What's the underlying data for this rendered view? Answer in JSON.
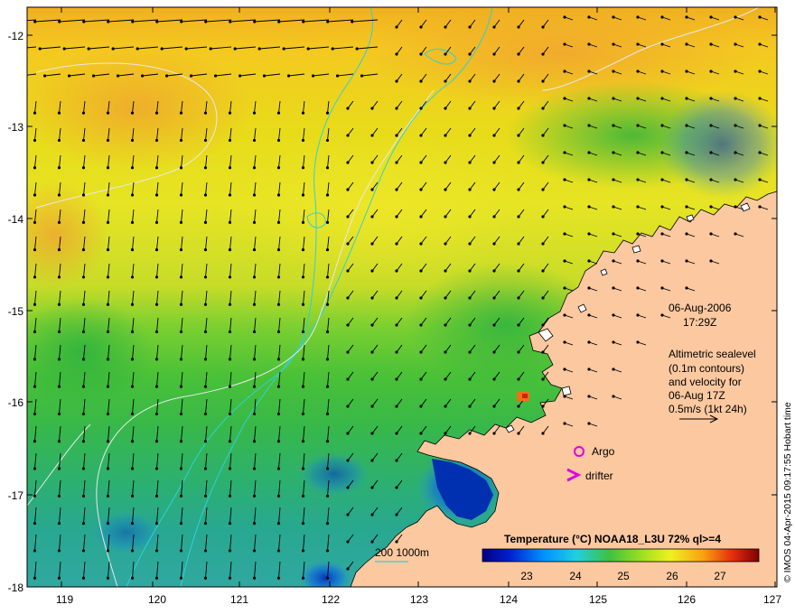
{
  "map": {
    "axes": {
      "lon_ticks": [
        "119",
        "120",
        "121",
        "122",
        "123",
        "124",
        "125",
        "126",
        "127"
      ],
      "lat_ticks": [
        "-12",
        "-13",
        "-14",
        "-15",
        "-16",
        "-17",
        "-18"
      ]
    },
    "info": {
      "date": "06-Aug-2006",
      "time": "17:29Z",
      "sealevel_lines": [
        "Altimetric sealevel",
        "(0.1m contours)",
        "and velocity for",
        "06-Aug 17Z",
        "0.5m/s (1kt 24h)"
      ]
    },
    "markers": {
      "argo_label": "Argo",
      "drifter_label": "drifter"
    },
    "bathymetry_legend": "200  1000m",
    "colorbar": {
      "title": "Temperature (°C) NOAA18_L3U 72% ql>=4",
      "ticks": [
        "23",
        "24",
        "25",
        "26",
        "27"
      ]
    },
    "credit": "© IMOS 04-Apr-2015 09:17:55 Hobart time",
    "colors": {
      "land": "#fbc8a0",
      "argo_marker": "#e000e0",
      "drifter_marker": "#e000e0",
      "contour": "#e8e8e8",
      "bathymetry": "#2fd0d8"
    }
  }
}
